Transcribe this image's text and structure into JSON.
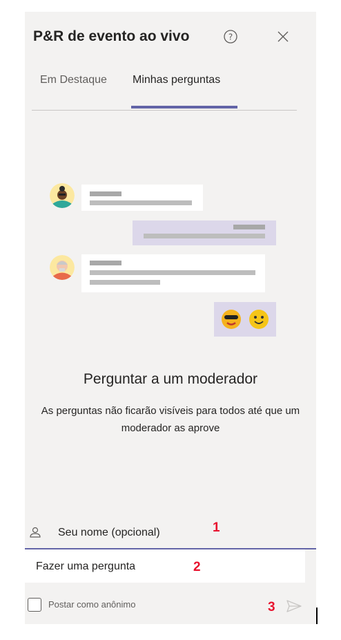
{
  "header": {
    "title": "P&R de evento ao vivo"
  },
  "tabs": [
    {
      "label": "Em Destaque"
    },
    {
      "label": "Minhas perguntas"
    }
  ],
  "empty_state": {
    "title": "Perguntar a um moderador",
    "description": "As perguntas não ficarão visíveis para todos até que um moderador as aprove"
  },
  "form": {
    "name_placeholder": "Seu nome (opcional)",
    "question_placeholder": "Fazer uma pergunta",
    "anonymous_label": "Postar como anônimo"
  },
  "annotations": {
    "marker1": "1",
    "marker2": "2",
    "marker3": "3"
  },
  "colors": {
    "accent": "#6264a7",
    "panel_bg": "#f3f2f1",
    "marker": "#e8122e"
  }
}
